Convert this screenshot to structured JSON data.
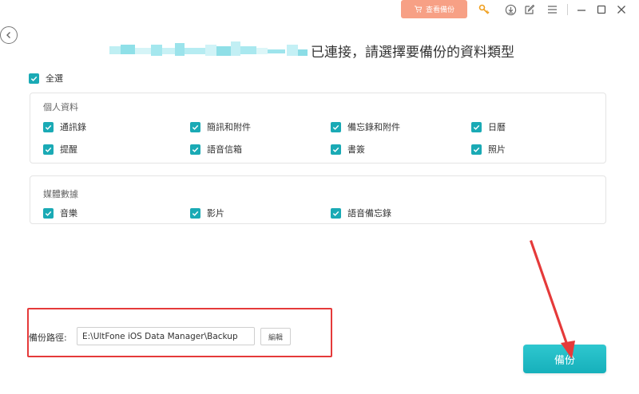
{
  "titlebar": {
    "view_backup_label": "查看備份",
    "icons": [
      "cart-icon",
      "key-icon",
      "download-icon",
      "edit-icon",
      "menu-icon",
      "minimize-icon",
      "maximize-icon",
      "close-icon"
    ]
  },
  "heading": {
    "text": "已連接，請選擇要備份的資料類型"
  },
  "select_all": {
    "label": "全選",
    "checked": true
  },
  "personal": {
    "title": "個人資料",
    "items": [
      {
        "label": "通訊錄",
        "checked": true
      },
      {
        "label": "簡訊和附件",
        "checked": true
      },
      {
        "label": "備忘錄和附件",
        "checked": true
      },
      {
        "label": "日曆",
        "checked": true
      },
      {
        "label": "提醒",
        "checked": true
      },
      {
        "label": "語音信箱",
        "checked": true
      },
      {
        "label": "書簽",
        "checked": true
      },
      {
        "label": "照片",
        "checked": true
      }
    ]
  },
  "media": {
    "title": "媒體數據",
    "items": [
      {
        "label": "音樂",
        "checked": true
      },
      {
        "label": "影片",
        "checked": true
      },
      {
        "label": "語音備忘錄",
        "checked": true
      }
    ]
  },
  "backup_path": {
    "label": "備份路徑:",
    "value": "E:\\UltFone iOS Data Manager\\Backup",
    "edit_label": "編輯"
  },
  "backup_button": {
    "label": "備份"
  },
  "colors": {
    "accent": "#1aaab5",
    "view_backup": "#f7a085",
    "highlight": "#e53a3a"
  }
}
